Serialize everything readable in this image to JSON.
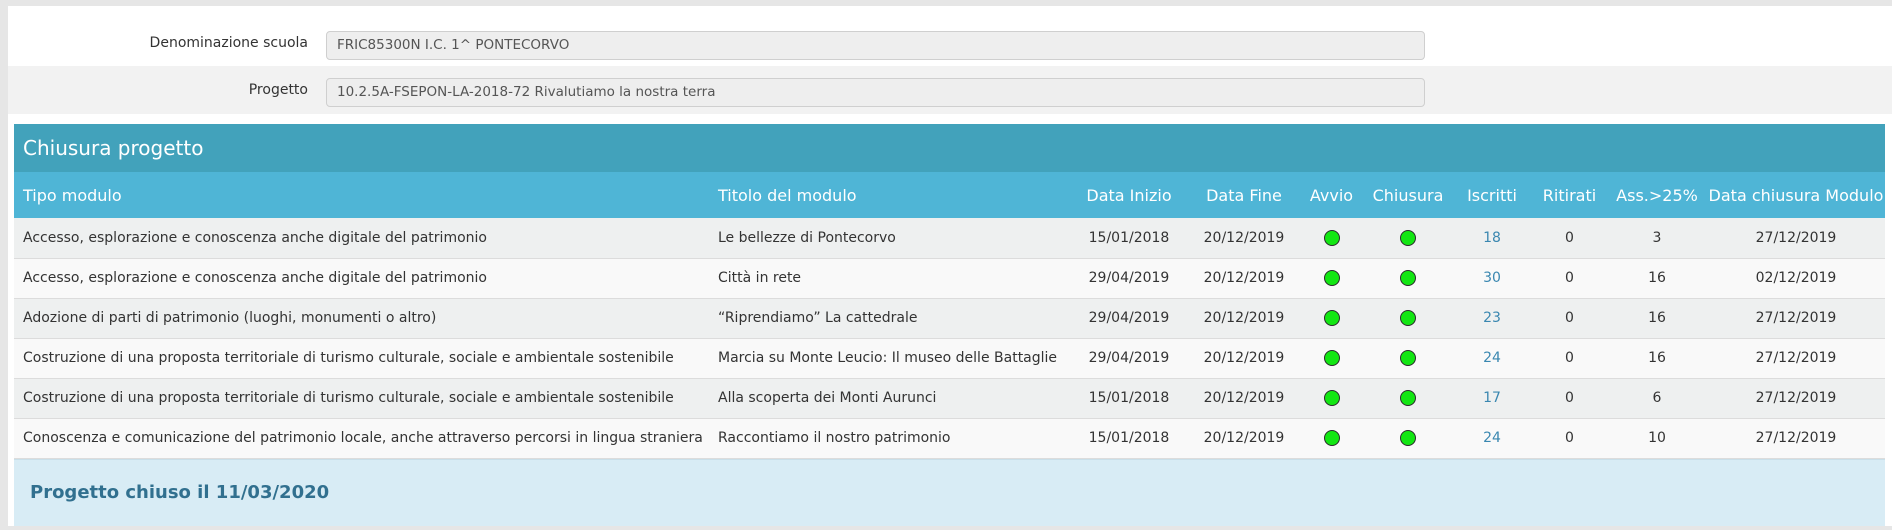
{
  "form": {
    "school_label": "Denominazione scuola",
    "school_value": "FRIC85300N I.C. 1^ PONTECORVO",
    "project_label": "Progetto",
    "project_value": "10.2.5A-FSEPON-LA-2018-72 Rivalutiamo la nostra terra"
  },
  "table": {
    "caption": "Chiusura progetto",
    "headers": {
      "tipo": "Tipo modulo",
      "titolo": "Titolo del modulo",
      "inizio": "Data Inizio",
      "fine": "Data Fine",
      "avvio": "Avvio",
      "chiusura": "Chiusura",
      "iscritti": "Iscritti",
      "ritirati": "Ritirati",
      "ass": "Ass.>25%",
      "data_chiusura": "Data chiusura Modulo"
    },
    "rows": [
      {
        "tipo": "Accesso, esplorazione e conoscenza anche digitale del patrimonio",
        "titolo": "Le bellezze di Pontecorvo",
        "inizio": "15/01/2018",
        "fine": "20/12/2019",
        "iscritti": "18",
        "ritirati": "0",
        "ass": "3",
        "data_chiusura": "27/12/2019"
      },
      {
        "tipo": "Accesso, esplorazione e conoscenza anche digitale del patrimonio",
        "titolo": "Città in rete",
        "inizio": "29/04/2019",
        "fine": "20/12/2019",
        "iscritti": "30",
        "ritirati": "0",
        "ass": "16",
        "data_chiusura": "02/12/2019"
      },
      {
        "tipo": "Adozione di parti di patrimonio (luoghi, monumenti o altro)",
        "titolo": "“Riprendiamo” La cattedrale",
        "inizio": "29/04/2019",
        "fine": "20/12/2019",
        "iscritti": "23",
        "ritirati": "0",
        "ass": "16",
        "data_chiusura": "27/12/2019"
      },
      {
        "tipo": "Costruzione di una proposta territoriale di turismo culturale, sociale e ambientale sostenibile",
        "titolo": "Marcia su Monte Leucio: Il museo delle Battaglie",
        "inizio": "29/04/2019",
        "fine": "20/12/2019",
        "iscritti": "24",
        "ritirati": "0",
        "ass": "16",
        "data_chiusura": "27/12/2019"
      },
      {
        "tipo": "Costruzione di una proposta territoriale di turismo culturale, sociale e ambientale sostenibile",
        "titolo": "Alla scoperta dei Monti Aurunci",
        "inizio": "15/01/2018",
        "fine": "20/12/2019",
        "iscritti": "17",
        "ritirati": "0",
        "ass": "6",
        "data_chiusura": "27/12/2019"
      },
      {
        "tipo": "Conoscenza e comunicazione del patrimonio locale, anche attraverso percorsi in lingua straniera",
        "titolo": "Raccontiamo il nostro patrimonio",
        "inizio": "15/01/2018",
        "fine": "20/12/2019",
        "iscritti": "24",
        "ritirati": "0",
        "ass": "10",
        "data_chiusura": "27/12/2019"
      }
    ],
    "status_icon": "green-status-dot-icon",
    "status_color": "#13e613",
    "footer": "Progetto chiuso il 11/03/2020"
  }
}
